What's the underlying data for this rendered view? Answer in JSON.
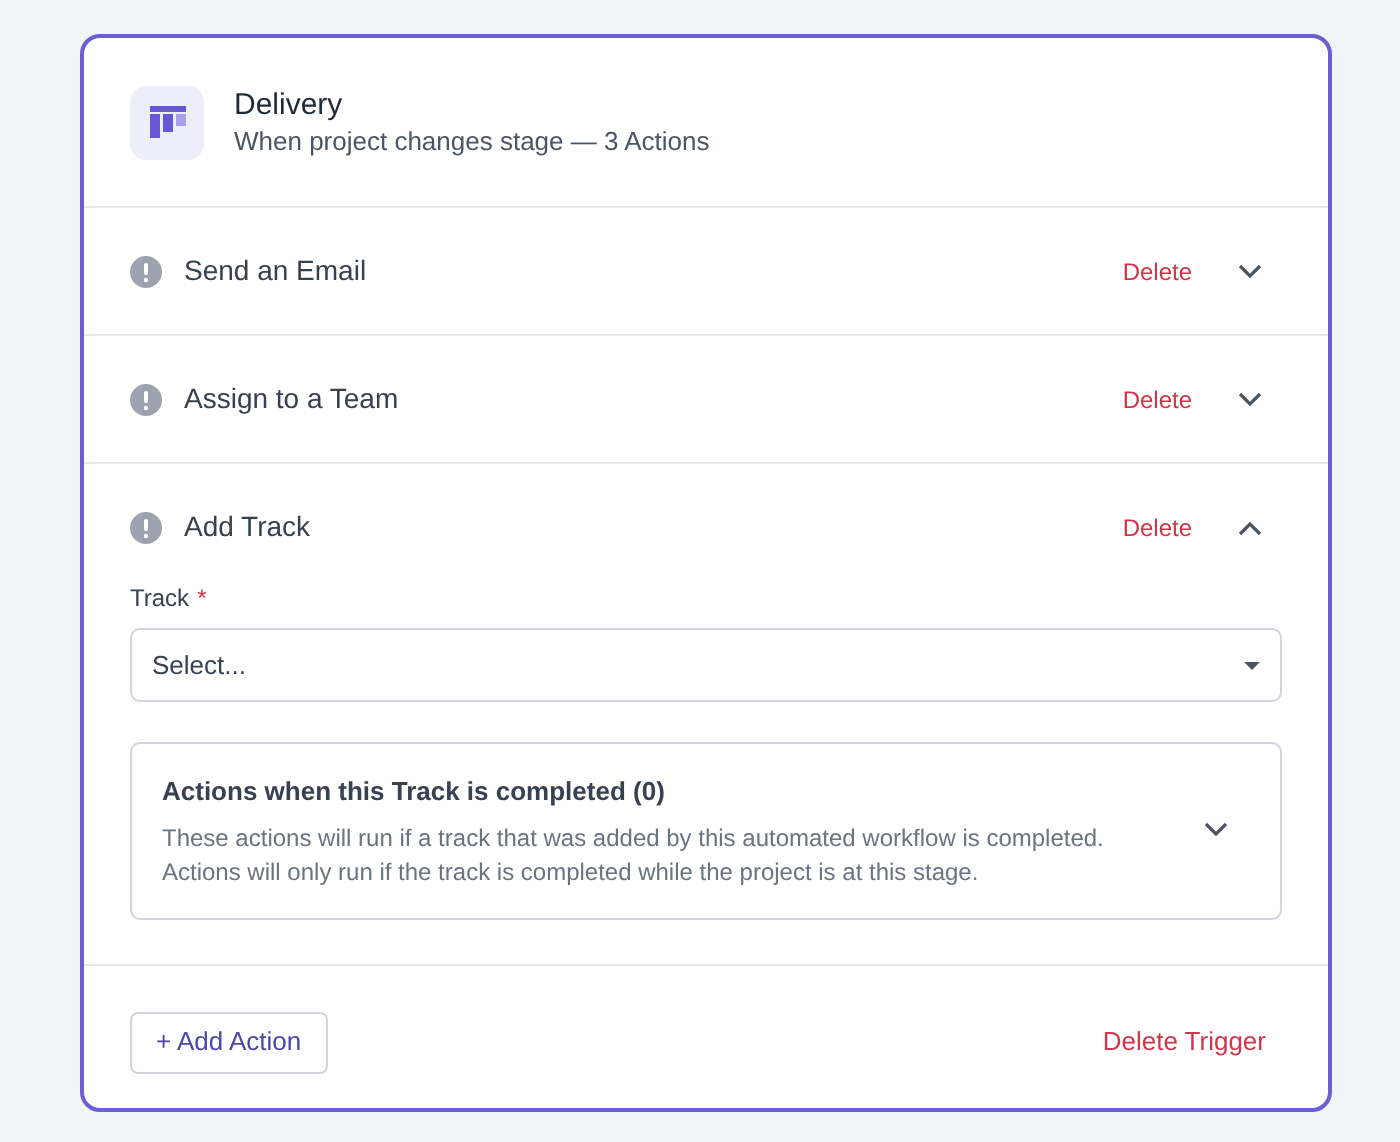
{
  "trigger": {
    "title": "Delivery",
    "subtitle": "When project changes stage — 3 Actions"
  },
  "actions": [
    {
      "title": "Send an Email",
      "delete_label": "Delete",
      "expanded": false
    },
    {
      "title": "Assign to a Team",
      "delete_label": "Delete",
      "expanded": false
    },
    {
      "title": "Add Track",
      "delete_label": "Delete",
      "expanded": true,
      "field": {
        "label": "Track",
        "required_mark": "*",
        "placeholder": "Select..."
      },
      "subpanel": {
        "title": "Actions when this Track is completed (0)",
        "description": "These actions will run if a track that was added by this automated workflow is completed. Actions will only run if the track is completed while the project is at this stage.",
        "expanded": false
      }
    }
  ],
  "footer": {
    "add_button": "+ Add Action",
    "delete_trigger": "Delete Trigger"
  }
}
